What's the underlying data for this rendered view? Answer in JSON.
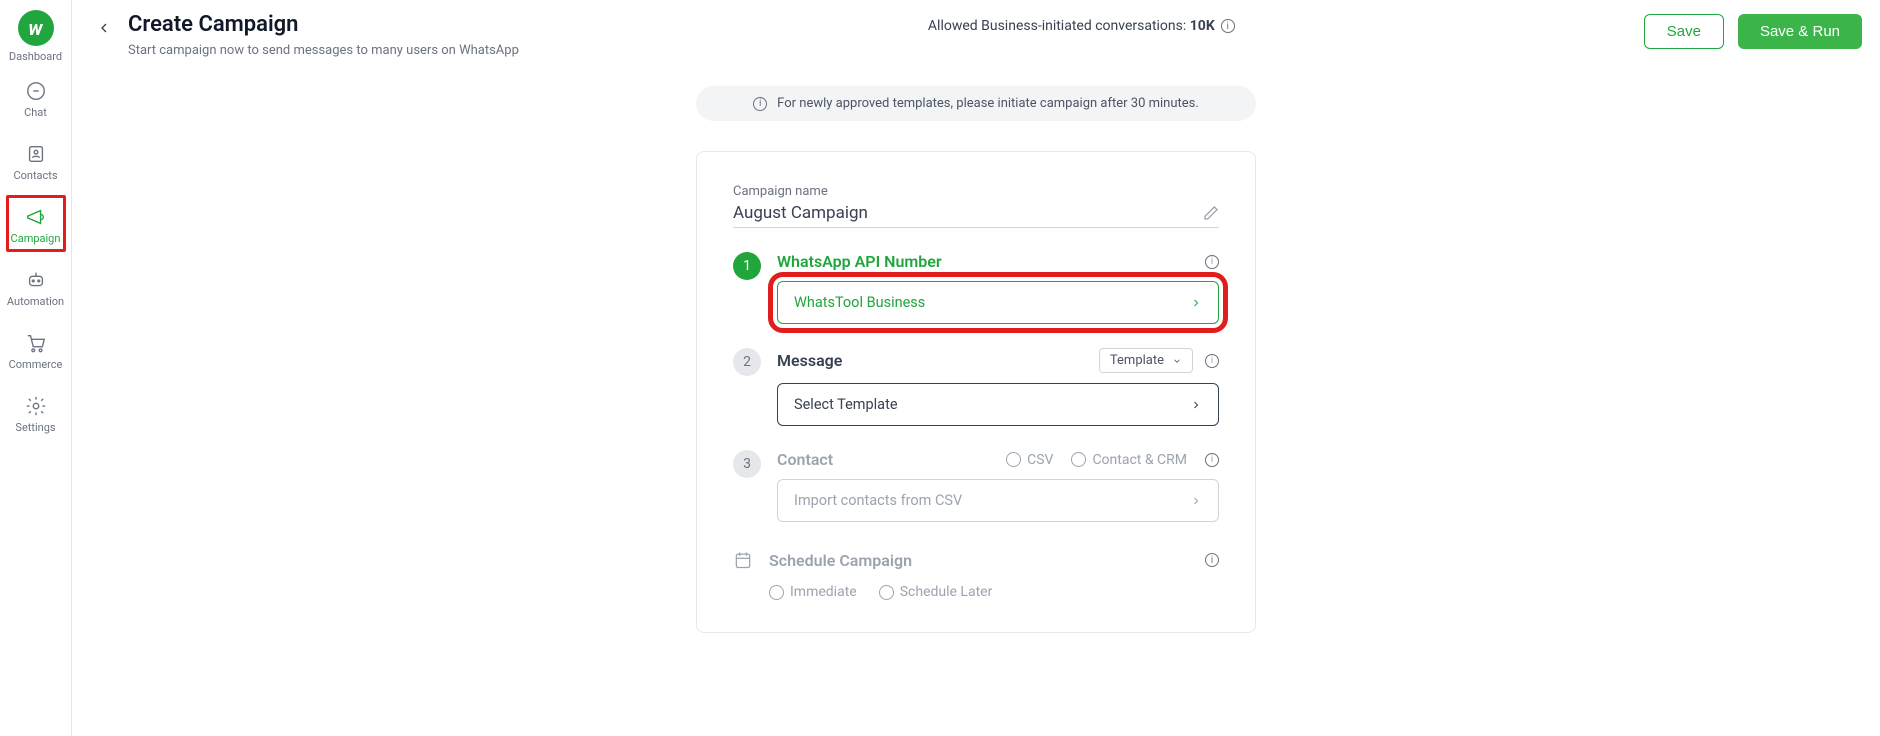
{
  "sidebar": {
    "items": [
      {
        "label": "Dashboard"
      },
      {
        "label": "Chat"
      },
      {
        "label": "Contacts"
      },
      {
        "label": "Campaign"
      },
      {
        "label": "Automation"
      },
      {
        "label": "Commerce"
      },
      {
        "label": "Settings"
      }
    ]
  },
  "header": {
    "title": "Create Campaign",
    "subtitle": "Start campaign now to send messages to many users on WhatsApp",
    "allowed_prefix": "Allowed Business-initiated conversations: ",
    "allowed_value": "10K",
    "save_label": "Save",
    "save_run_label": "Save & Run"
  },
  "banner": {
    "text": "For newly approved templates, please initiate campaign after 30 minutes."
  },
  "form": {
    "campaign_name_label": "Campaign name",
    "campaign_name_value": "August Campaign",
    "step1": {
      "num": "1",
      "title": "WhatsApp API Number",
      "value": "WhatsTool Business"
    },
    "step2": {
      "num": "2",
      "title": "Message",
      "type_label": "Template",
      "placeholder": "Select Template"
    },
    "step3": {
      "num": "3",
      "title": "Contact",
      "opt_csv": "CSV",
      "opt_crm": "Contact & CRM",
      "placeholder": "Import contacts from CSV"
    },
    "schedule": {
      "title": "Schedule Campaign",
      "opt_immediate": "Immediate",
      "opt_later": "Schedule Later"
    }
  }
}
